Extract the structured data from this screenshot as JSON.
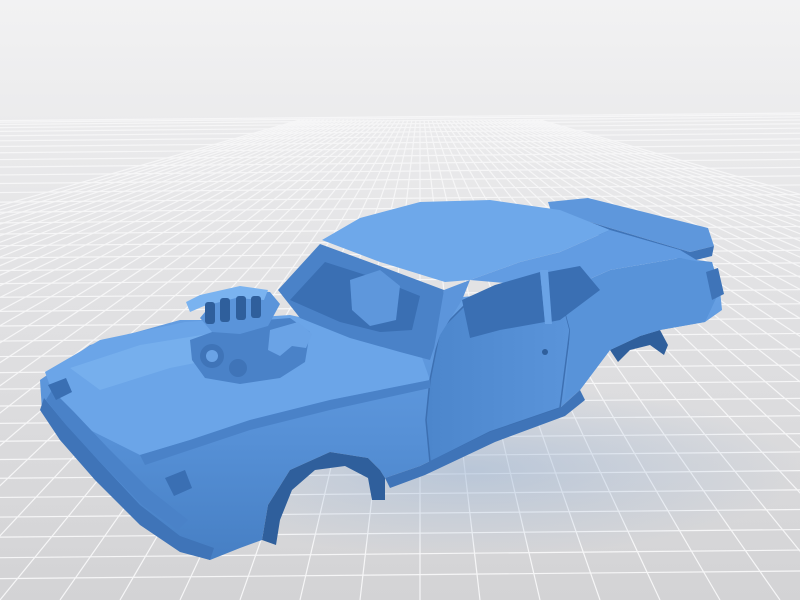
{
  "scene": {
    "type": "3d-model-render",
    "subject": "car-body-shell-with-blower-engine",
    "colors": {
      "background_top": "#f0f0f1",
      "background_mid": "#dcdcdd",
      "floor": "#cfd0d2",
      "grid_line": "#f4f4f5",
      "model_base": "#5b93d8",
      "model_light": "#7ab0ee",
      "model_dark": "#3f74b8",
      "model_shadow": "#2f5f9c",
      "reflection": "#c8d6ea"
    }
  }
}
